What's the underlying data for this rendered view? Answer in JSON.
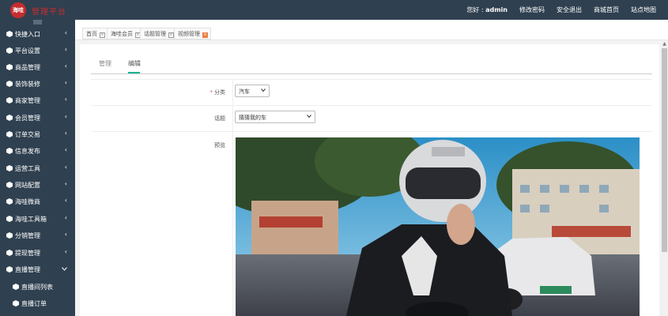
{
  "header": {
    "logo_text": "海哇",
    "brand": "管理平台",
    "greeting_prefix": "您好 : ",
    "username": "admin",
    "nav": [
      "修改密码",
      "安全退出",
      "商城首页",
      "站点地图"
    ]
  },
  "sidebar": {
    "items": [
      {
        "label": "快捷入口"
      },
      {
        "label": "平台设置"
      },
      {
        "label": "商品管理"
      },
      {
        "label": "装饰装修"
      },
      {
        "label": "商家管理"
      },
      {
        "label": "会员管理"
      },
      {
        "label": "订单交易"
      },
      {
        "label": "信息发布"
      },
      {
        "label": "运营工具"
      },
      {
        "label": "网站配置"
      },
      {
        "label": "海哇微商"
      },
      {
        "label": "海哇工具箱"
      },
      {
        "label": "分销管理"
      },
      {
        "label": "提现管理"
      },
      {
        "label": "直播管理",
        "expanded": true
      }
    ],
    "subitems": [
      {
        "label": "直播间列表"
      },
      {
        "label": "直播订单"
      }
    ]
  },
  "tabs": [
    {
      "label": "首页"
    },
    {
      "label": "海哇会员"
    },
    {
      "label": "话题管理"
    },
    {
      "label": "视频管理",
      "active": true
    }
  ],
  "panel": {
    "subtabs": [
      "管理",
      "编辑"
    ],
    "active_subtab": "编辑",
    "form": {
      "category": {
        "label": "分类",
        "required": true,
        "value": "汽车"
      },
      "topic": {
        "label": "话题",
        "value": "猜猜我的车"
      },
      "preview": {
        "label": "预览"
      }
    }
  },
  "colors": {
    "sidebar_bg": "#2f4050",
    "accent": "#1ab394",
    "brand_red": "#c52d2f",
    "active_tab_close": "#e98245"
  }
}
